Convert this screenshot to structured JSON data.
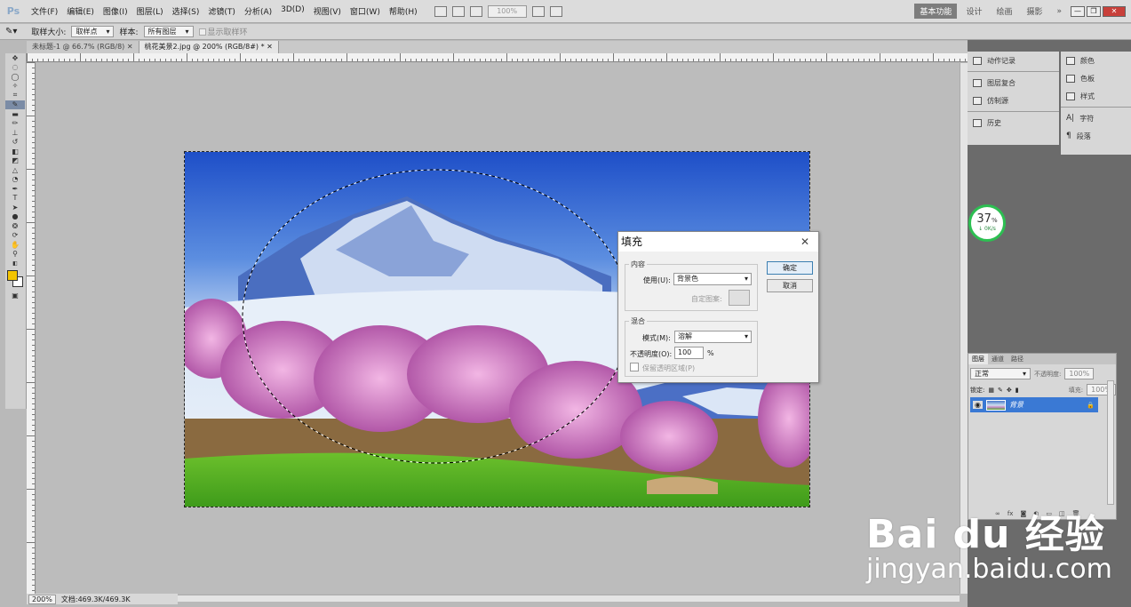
{
  "app": {
    "logo": "Ps"
  },
  "menu": [
    "文件(F)",
    "编辑(E)",
    "图像(I)",
    "图层(L)",
    "选择(S)",
    "滤镜(T)",
    "分析(A)",
    "3D(D)",
    "视图(V)",
    "窗口(W)",
    "帮助(H)"
  ],
  "menubar": {
    "zoom": "100%"
  },
  "workspaces": [
    {
      "label": "基本功能",
      "active": true
    },
    {
      "label": "设计",
      "active": false
    },
    {
      "label": "绘画",
      "active": false
    },
    {
      "label": "摄影",
      "active": false
    }
  ],
  "window_controls": {
    "more": "»",
    "minimize": "—",
    "restore": "❐",
    "close": "✕"
  },
  "options": {
    "sample_size_label": "取样大小:",
    "sample_size_value": "取样点",
    "sample_label": "样本:",
    "sample_value": "所有图层",
    "show_ring_label": "显示取样环"
  },
  "tabs": [
    {
      "label": "未标题-1 @ 66.7% (RGB/8)",
      "active": false
    },
    {
      "label": "桃花美景2.jpg @ 200% (RGB/8#) *",
      "active": true
    }
  ],
  "tab_close": "✕",
  "status": {
    "zoom": "200%",
    "doc": "文档:469.3K/469.3K"
  },
  "panels_left": [
    "动作记录",
    "图层复合",
    "仿制源",
    "历史"
  ],
  "panels_right": [
    "颜色",
    "色板",
    "样式",
    "字符",
    "段落"
  ],
  "progress": {
    "percent": "37",
    "unit": "%",
    "speed": "↓ 0K/s"
  },
  "layers_panel": {
    "tabs": [
      "图层",
      "通道",
      "路径"
    ],
    "blend_mode": "正常",
    "opacity_label": "不透明度:",
    "opacity": "100%",
    "lock_label": "锁定:",
    "fill_label": "填充:",
    "fill": "100%",
    "layer_name": "背景",
    "lock_icon": "🔒"
  },
  "dialog": {
    "title": "填充",
    "content_label": "内容",
    "use_label": "使用(U):",
    "use_value": "背景色",
    "custom_pattern_label": "自定图案:",
    "blend_label": "混合",
    "mode_label": "模式(M):",
    "mode_value": "溶解",
    "opacity_label": "不透明度(O):",
    "opacity_value": "100",
    "opacity_unit": "%",
    "preserve_label": "保留透明区域(P)",
    "ok": "确定",
    "cancel": "取消"
  },
  "watermark": {
    "main": "Bai du 经验",
    "sub": "jingyan.baidu.com"
  },
  "colors": {
    "accent": "#3a79d4",
    "foreground": "#f4c400",
    "background": "#ffffff"
  }
}
